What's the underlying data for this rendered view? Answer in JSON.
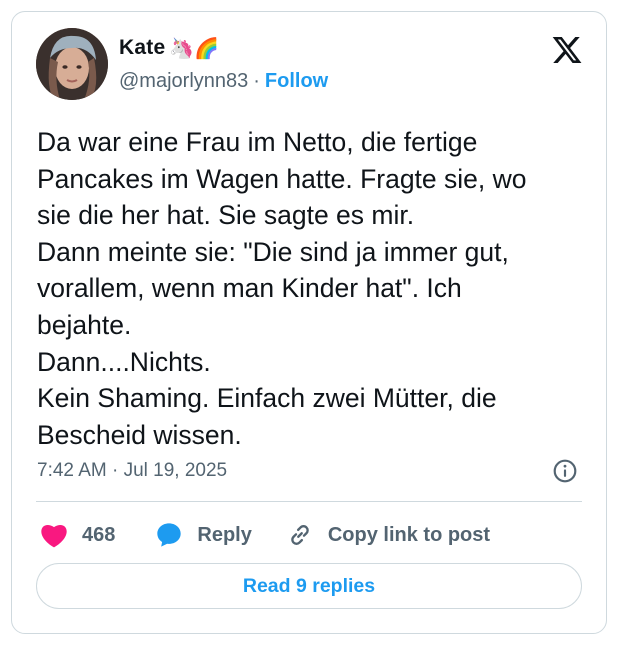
{
  "author": {
    "name": "Kate",
    "emoji": "🦄🌈",
    "handle": "@majorlynn83",
    "separator": "·",
    "follow_label": "Follow"
  },
  "tweet": {
    "text": "Da war eine Frau im Netto, die fertige\nPancakes im Wagen hatte. Fragte sie, wo\nsie die her hat. Sie sagte es mir.\nDann meinte sie: \"Die sind ja immer gut,\nvorallem, wenn man Kinder hat\". Ich\nbejahte.\nDann....Nichts.\nKein Shaming. Einfach zwei Mütter, die\nBescheid wissen.",
    "timestamp": "7:42 AM · Jul 19, 2025"
  },
  "actions": {
    "like_count": "468",
    "reply_label": "Reply",
    "copy_label": "Copy link to post"
  },
  "read_replies_label": "Read 9 replies",
  "colors": {
    "accent": "#1d9bf0",
    "heart": "#f91880",
    "muted": "#536471",
    "text": "#0f1419",
    "border": "#cfd9de"
  },
  "icons": [
    "x-logo-icon",
    "info-icon",
    "heart-icon",
    "reply-bubble-icon",
    "link-icon"
  ]
}
